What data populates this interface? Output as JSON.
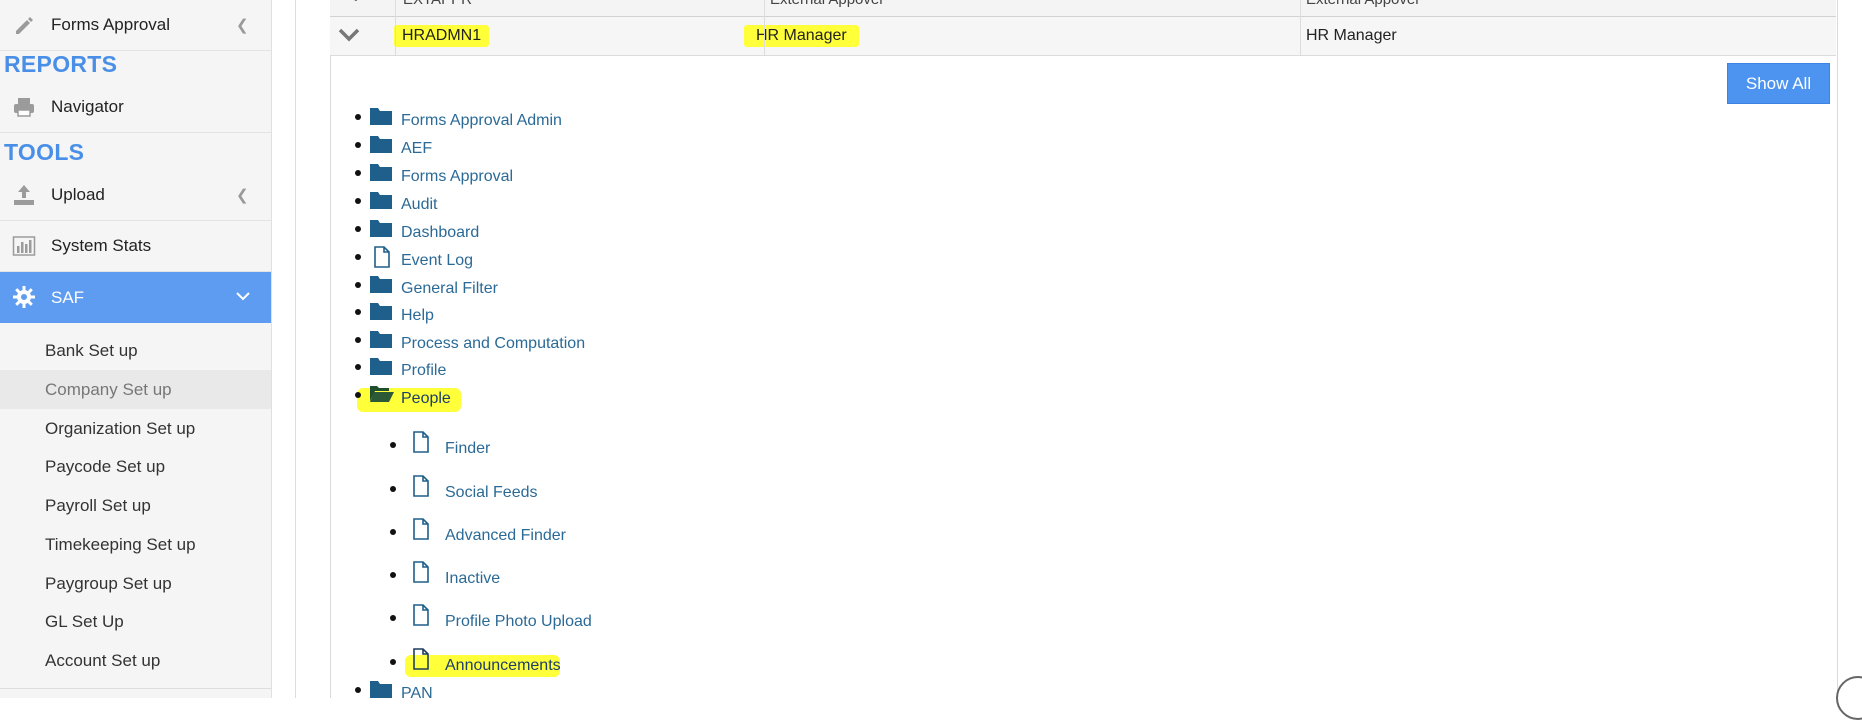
{
  "sidebar": {
    "forms_approval": "Forms Approval",
    "reports_header": "REPORTS",
    "navigator": "Navigator",
    "tools_header": "TOOLS",
    "upload": "Upload",
    "system_stats": "System Stats",
    "saf": "SAF",
    "saf_items": [
      "Bank Set up",
      "Company Set up",
      "Organization Set up",
      "Paycode Set up",
      "Payroll Set up",
      "Timekeeping Set up",
      "Paygroup Set up",
      "GL Set Up",
      "Account Set up"
    ]
  },
  "grid": {
    "header": {
      "col1": "EXTAPPR",
      "col2": "External Appover",
      "col3": "External Appover"
    },
    "row": {
      "code": "HRADMN1",
      "role": "HR Manager",
      "description": "HR Manager"
    }
  },
  "buttons": {
    "show_all": "Show All"
  },
  "tree": {
    "nodes": [
      "Forms Approval Admin",
      "AEF",
      "Forms Approval",
      "Audit",
      "Dashboard",
      "Event Log",
      "General Filter",
      "Help",
      "Process and Computation",
      "Profile",
      "People"
    ],
    "people_children": [
      "Finder",
      "Social Feeds",
      "Advanced Finder",
      "Inactive",
      "Profile Photo Upload",
      "Announcements"
    ],
    "next_node": "PAN"
  },
  "colors": {
    "accent": "#5d9cf0",
    "section": "#4a8fe7",
    "link": "#2b6a96",
    "folder": "#1f5f8b",
    "highlight": "#ffff3a"
  }
}
